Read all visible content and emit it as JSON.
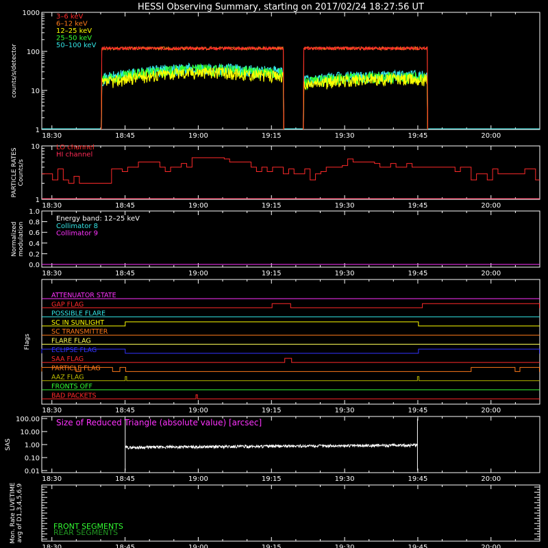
{
  "title": "HESSI Observing Summary, starting on 2017/02/24 18:27:56 UT",
  "time_axis": {
    "start": "18:27:56",
    "end": "20:10:00",
    "ticks": [
      "18:30",
      "18:45",
      "19:00",
      "19:15",
      "19:30",
      "19:45",
      "20:00"
    ],
    "tick_minutes": [
      2.07,
      17.07,
      32.07,
      47.07,
      62.07,
      77.07,
      92.07
    ]
  },
  "chart_data": [
    {
      "type": "line",
      "id": "count-rates",
      "ylabel": "counts/s/detector",
      "yscale": "log",
      "ylim": [
        1,
        1000
      ],
      "yticks": [
        "1",
        "10",
        "100",
        "1000"
      ],
      "data_gaps": [
        [
          "18:27:56",
          "18:40:10"
        ],
        [
          "19:17:30",
          "19:21:30"
        ],
        [
          "19:47:00",
          "20:10:00"
        ]
      ],
      "series": [
        {
          "name": "3–6 keV",
          "color": "#ff2a2a",
          "level": 120
        },
        {
          "name": "6–12 keV",
          "color": "#ff7a1a",
          "level": 120
        },
        {
          "name": "12–25 keV",
          "color": "#ffff00",
          "level_start": 15,
          "level_peak": 30,
          "level_end": 18
        },
        {
          "name": "25–50 keV",
          "color": "#33ff33",
          "level_start": 18,
          "level_peak": 35,
          "level_end": 20
        },
        {
          "name": "50–100 keV",
          "color": "#33e6e6",
          "level_start": 20,
          "level_peak": 38,
          "level_end": 22
        }
      ]
    },
    {
      "type": "line",
      "id": "particle-rates",
      "ylabel": "PARTICLE RATES",
      "ylabel2": "Counts/s",
      "yscale": "log",
      "ylim": [
        1,
        10
      ],
      "yticks": [
        "1",
        "10"
      ],
      "series": [
        {
          "name": "LO channel",
          "color": "#ff2a2a"
        },
        {
          "name": "HI channel",
          "color": "#ff2a55"
        }
      ],
      "steps": [
        [
          0,
          3
        ],
        [
          5,
          2
        ],
        [
          14,
          3
        ],
        [
          16,
          4
        ],
        [
          19,
          5
        ],
        [
          23,
          4
        ],
        [
          30,
          6
        ],
        [
          36,
          5
        ],
        [
          42,
          4
        ],
        [
          48,
          3
        ],
        [
          55,
          4
        ],
        [
          60,
          5
        ],
        [
          66,
          4
        ],
        [
          72,
          4
        ],
        [
          80,
          4
        ],
        [
          86,
          3
        ],
        [
          100,
          3
        ]
      ]
    },
    {
      "type": "line",
      "id": "modulation",
      "ylabel": "Normalized",
      "ylabel2": "modulation",
      "ylim": [
        0,
        1
      ],
      "yticks": [
        "0.0",
        "0.2",
        "0.4",
        "0.6",
        "0.8",
        "1.0"
      ],
      "annotation": "Energy band: 12–25 keV",
      "series": [
        {
          "name": "Collimator 8",
          "color": "#33e6e6",
          "value": 0
        },
        {
          "name": "Collimator 9",
          "color": "#ff33ff",
          "value": 0
        }
      ]
    },
    {
      "type": "line",
      "id": "flags",
      "ylabel": "Flags",
      "series": [
        {
          "name": "ATTENUATOR STATE",
          "color": "#ff33ff",
          "segments": []
        },
        {
          "name": "GAP FLAG",
          "color": "#ff2a2a",
          "segments": [
            [
              47.2,
              51.0
            ],
            [
              78.0,
              102.0
            ]
          ]
        },
        {
          "name": "POSSIBLE FLARE",
          "color": "#33e6e6",
          "segments": []
        },
        {
          "name": "SC IN SUNLIGHT",
          "color": "#ffff00",
          "segments": [
            [
              17.1,
              77.2
            ]
          ]
        },
        {
          "name": "SC TRANSMITTER",
          "color": "#ff7a1a",
          "segments": []
        },
        {
          "name": "FLARE FLAG",
          "color": "#ffff55",
          "segments": []
        },
        {
          "name": "ECLIPSE FLAG",
          "color": "#3333ff",
          "segments": [
            [
              0,
              17.1
            ],
            [
              77.2,
              102.0
            ]
          ]
        },
        {
          "name": "SAA FLAG",
          "color": "#ff2a2a",
          "segments": [
            [
              49.8,
              51.2
            ]
          ]
        },
        {
          "name": "PARTICLE FLAG",
          "color": "#ff7a1a",
          "segments": [
            [
              0,
              7.0
            ],
            [
              8.0,
              14.5
            ],
            [
              16.0,
              17.2
            ],
            [
              88.0,
              97.0
            ],
            [
              98.0,
              102.0
            ]
          ]
        },
        {
          "name": "AAZ FLAG",
          "color": "#bbbb00",
          "segments": [
            [
              17.1,
              17.4
            ],
            [
              77.0,
              77.3
            ]
          ]
        },
        {
          "name": "FRONTS OFF",
          "color": "#33ff33",
          "segments": []
        },
        {
          "name": "BAD PACKETS",
          "color": "#ff2a2a",
          "segments": [
            [
              31.6,
              31.9
            ]
          ]
        }
      ]
    },
    {
      "type": "line",
      "id": "sas",
      "ylabel": "SAS",
      "yscale": "log",
      "ylim": [
        0.01,
        100
      ],
      "yticks": [
        "0.01",
        "0.10",
        "1.00",
        "10.00",
        "100.00"
      ],
      "annotation": "Size of Reduced Triangle (absolute value) [arcsec]",
      "series": [
        {
          "name": "Size of Reduced Triangle",
          "color": "#ffffff",
          "start": 17.1,
          "end": 77.0,
          "level_start": 0.6,
          "level_end": 0.9,
          "spike": 100
        }
      ]
    },
    {
      "type": "line",
      "id": "livetime",
      "ylabel": "Mon. Rate LIVETIME",
      "ylabel2": "avg of D1,3,4,5,6,9",
      "series": [
        {
          "name": "FRONT SEGMENTS",
          "color": "#33ff33"
        },
        {
          "name": "REAR SEGMENTS",
          "color": "#229922"
        }
      ]
    }
  ]
}
